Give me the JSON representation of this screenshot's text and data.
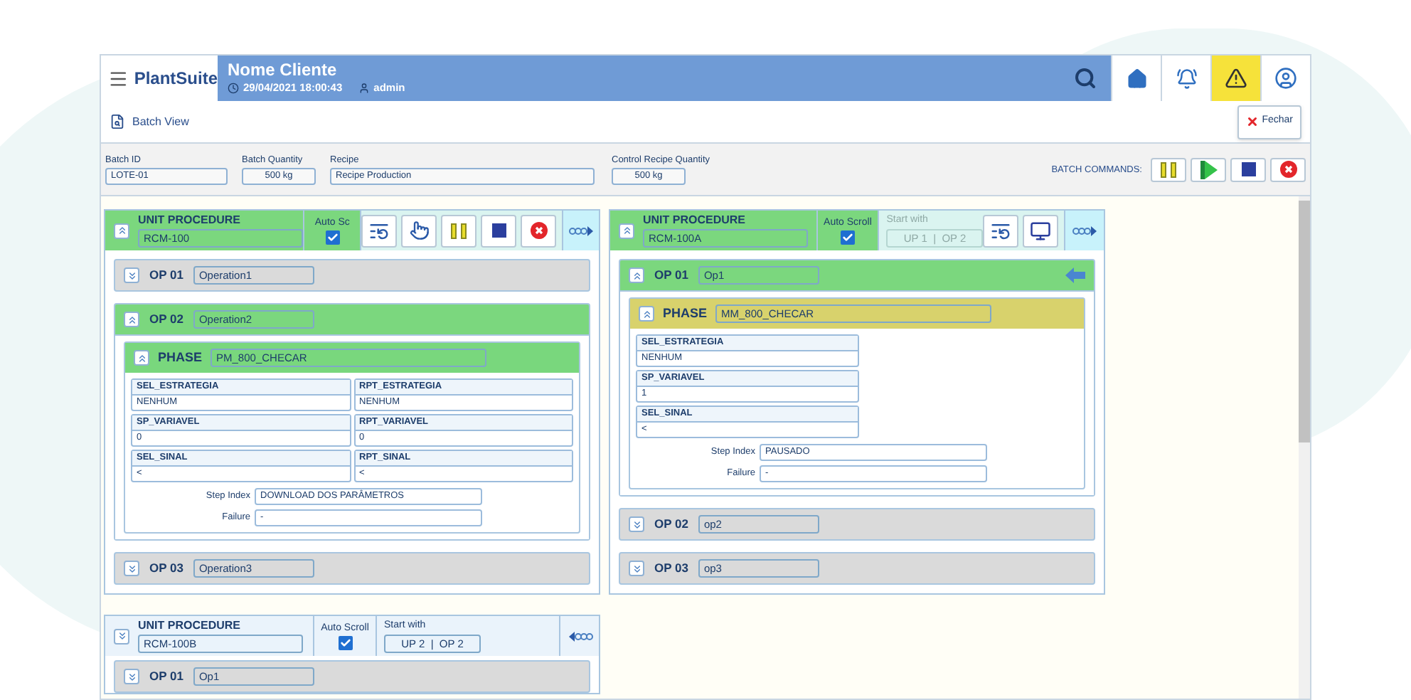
{
  "header": {
    "brand": "PlantSuite",
    "client": "Nome Cliente",
    "datetime": "29/04/2021 18:00:43",
    "user": "admin",
    "alert_active": true
  },
  "toolbar": {
    "title": "Batch View",
    "close_label": "Fechar"
  },
  "batch_fields": [
    {
      "label": "Batch ID",
      "value": "LOTE-01",
      "kind": "wide"
    },
    {
      "label": "Batch Quantity",
      "value": "500 kg",
      "kind": "short"
    },
    {
      "label": "Recipe",
      "value": "Recipe Production",
      "kind": "long"
    },
    {
      "label": "Control Recipe Quantity",
      "value": "500 kg",
      "kind": "short"
    }
  ],
  "batch_commands": {
    "label": "BATCH COMMANDS:",
    "buttons": [
      {
        "kind": "pause"
      },
      {
        "kind": "start"
      },
      {
        "kind": "stop"
      },
      {
        "kind": "abort"
      }
    ]
  },
  "unit_procedures": [
    {
      "title": "UNIT PROCEDURE",
      "name": "RCM-100",
      "active": true,
      "expanded": true,
      "auto_scroll_label": "Auto Sc",
      "auto_scroll": true,
      "tools": [
        {
          "kind": "reload"
        },
        {
          "kind": "manual"
        },
        {
          "kind": "pause"
        },
        {
          "kind": "stop"
        },
        {
          "kind": "abort"
        }
      ],
      "nav_back": false,
      "operations": [
        {
          "label": "OP 01",
          "name": "Operation1",
          "active": false,
          "expanded": false,
          "current": false
        },
        {
          "label": "OP 02",
          "name": "Operation2",
          "active": true,
          "expanded": true,
          "current": false,
          "phases": [
            {
              "label": "PHASE",
              "name": "PM_800_CHECAR",
              "paused": false,
              "two_columns": true,
              "parameters": [
                {
                  "name": "SEL_ESTRATEGIA",
                  "value": "NENHUM"
                },
                {
                  "name": "RPT_ESTRATEGIA",
                  "value": "NENHUM"
                },
                {
                  "name": "SP_VARIAVEL",
                  "value": "0"
                },
                {
                  "name": "RPT_VARIAVEL",
                  "value": "0"
                },
                {
                  "name": "SEL_SINAL",
                  "value": "<"
                },
                {
                  "name": "RPT_SINAL",
                  "value": "<"
                }
              ],
              "step_index_label": "Step Index",
              "step_index": "DOWNLOAD DOS PARÂMETROS",
              "failure_label": "Failure",
              "failure": "-"
            }
          ]
        },
        {
          "label": "OP 03",
          "name": "Operation3",
          "active": false,
          "expanded": false,
          "current": false
        }
      ]
    },
    {
      "title": "UNIT PROCEDURE",
      "name": "RCM-100A",
      "active": true,
      "expanded": true,
      "auto_scroll_label": "Auto Scroll",
      "auto_scroll": true,
      "start_with": {
        "label": "Start with",
        "value": "UP 1  |  OP 2",
        "disabled": true
      },
      "tools": [
        {
          "kind": "reload"
        },
        {
          "kind": "monitor"
        }
      ],
      "nav_back": false,
      "operations": [
        {
          "label": "OP 01",
          "name": "Op1",
          "active": true,
          "expanded": true,
          "current": true,
          "phases": [
            {
              "label": "PHASE",
              "name": "MM_800_CHECAR",
              "paused": true,
              "two_columns": false,
              "parameters": [
                {
                  "name": "SEL_ESTRATEGIA",
                  "value": "NENHUM"
                },
                {
                  "name": "SP_VARIAVEL",
                  "value": "1"
                },
                {
                  "name": "SEL_SINAL",
                  "value": "<"
                }
              ],
              "step_index_label": "Step Index",
              "step_index": "PAUSADO",
              "failure_label": "Failure",
              "failure": "-"
            }
          ]
        },
        {
          "label": "OP 02",
          "name": "op2",
          "active": false,
          "expanded": false,
          "current": false
        },
        {
          "label": "OP 03",
          "name": "op3",
          "active": false,
          "expanded": false,
          "current": false
        }
      ]
    },
    {
      "title": "UNIT PROCEDURE",
      "name": "RCM-100B",
      "active": false,
      "expanded": false,
      "auto_scroll_label": "Auto Scroll",
      "auto_scroll": true,
      "start_with": {
        "label": "Start with",
        "value": "UP 2  |  OP 2",
        "disabled": false
      },
      "nav_back": true,
      "operations": [
        {
          "label": "OP 01",
          "name": "Op1",
          "active": false,
          "expanded": false,
          "current": false
        }
      ]
    }
  ]
}
